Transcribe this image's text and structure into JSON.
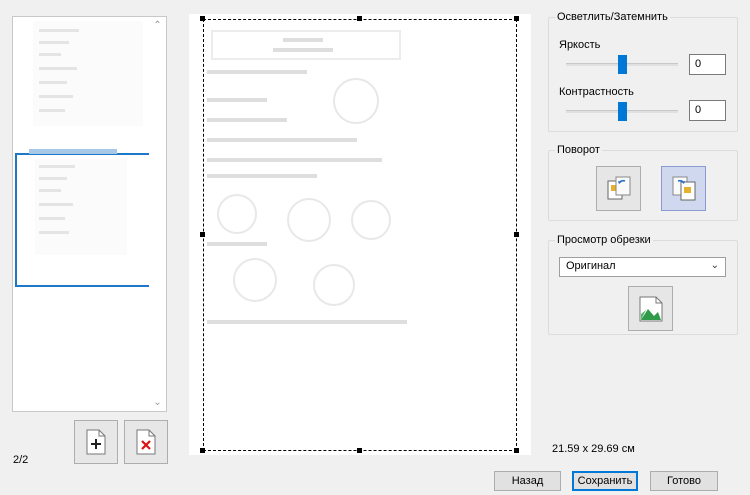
{
  "thumbnails": {
    "items": [
      {
        "name": "page-1",
        "selected": false
      },
      {
        "name": "page-2",
        "selected": true
      }
    ],
    "page_counter": "2/2",
    "add_page_icon": "add-page-icon",
    "delete_page_icon": "delete-page-icon"
  },
  "brightness_group": {
    "title": "Осветлить/Затемнить",
    "brightness_label": "Яркость",
    "brightness_value": "0",
    "brightness_level": 0.5,
    "contrast_label": "Контрастность",
    "contrast_value": "0",
    "contrast_level": 0.5
  },
  "rotation_group": {
    "title": "Поворот",
    "rotate_left_icon": "rotate-left-icon",
    "rotate_right_icon": "rotate-right-icon"
  },
  "crop_group": {
    "title": "Просмотр обрезки",
    "selected_option": "Оригинал",
    "preview_icon": "image-landscape-icon"
  },
  "page_size": "21.59 x 29.69 см",
  "footer": {
    "back_label": "Назад",
    "save_label": "Сохранить",
    "done_label": "Готово"
  },
  "colors": {
    "accent": "#0078d7",
    "selection_border": "#1e78c8"
  }
}
